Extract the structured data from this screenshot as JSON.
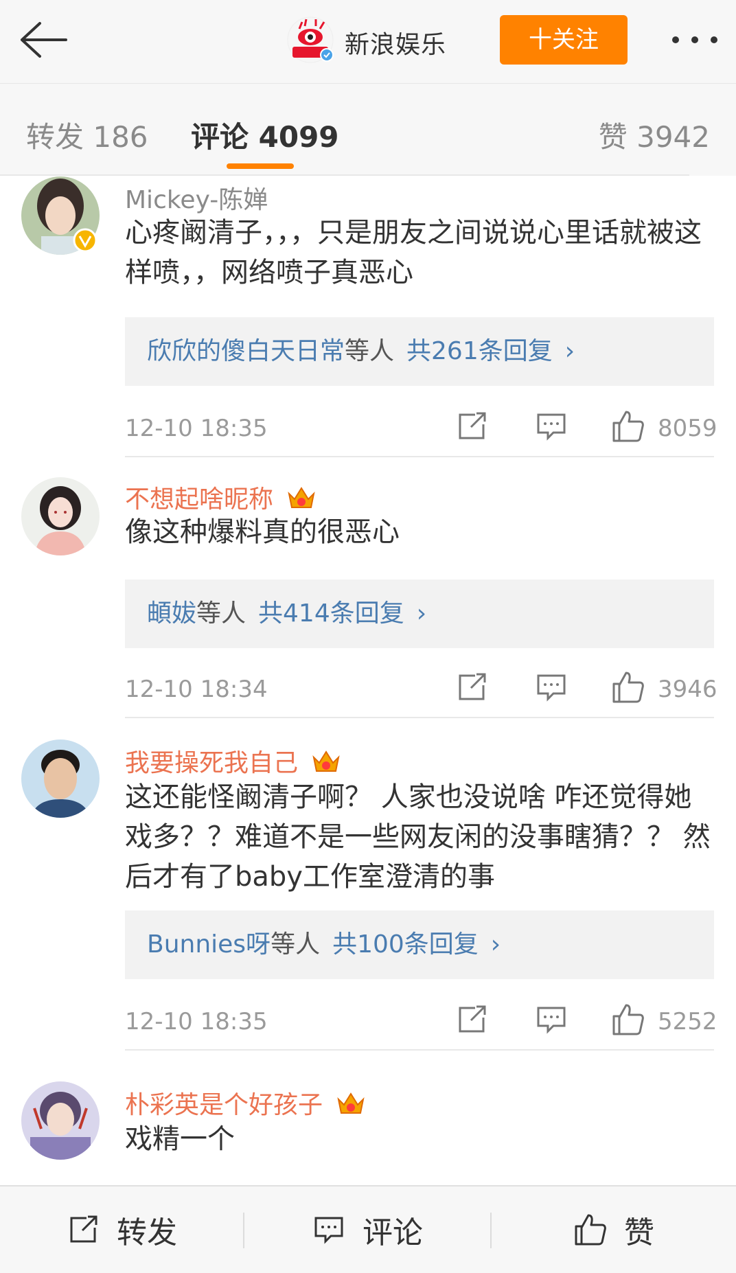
{
  "header": {
    "account_name": "新浪娱乐",
    "follow_label": "十关注",
    "avatar_badge_text": "新浪娱乐"
  },
  "tabs": {
    "repost": "转发 186",
    "comment": "评论 4099",
    "like": "赞 3942"
  },
  "comments": [
    {
      "user": "Mickey-陈婵",
      "text": "心疼阚清子，，，只是朋友之间说说心里话就被这样喷，，网络喷子真恶心",
      "reply_users": "欣欣的傻白天日常",
      "reply_mid": "等人",
      "reply_count": "共261条回复",
      "time": "12-10 18:35",
      "likes": "8059"
    },
    {
      "user": "不想起啥昵称",
      "text": "像这种爆料真的很恶心",
      "reply_users": "頔妭",
      "reply_mid": "等人",
      "reply_count": "共414条回复",
      "time": "12-10 18:34",
      "likes": "3946"
    },
    {
      "user": "我要操死我自己",
      "text": "这还能怪阚清子啊？ 人家也没说啥 咋还觉得她戏多？？难道不是一些网友闲的没事瞎猜？？ 然后才有了baby工作室澄清的事",
      "reply_users": "Bunnies呀",
      "reply_mid": "等人",
      "reply_count": "共100条回复",
      "time": "12-10 18:35",
      "likes": "5252"
    },
    {
      "user": "朴彩英是个好孩子",
      "text": "戏精一个"
    }
  ],
  "bottom": {
    "repost": "转发",
    "comment": "评论",
    "like": "赞"
  },
  "colors": {
    "accent": "#ff8200",
    "vip_name": "#eb7350",
    "link": "#4a7cb0"
  },
  "icons": {
    "back": "arrow-left-icon",
    "more": "more-dots-icon",
    "verified": "verified-badge-icon",
    "crown": "vip-crown-icon",
    "share": "share-icon",
    "reply": "comment-icon",
    "like": "thumbs-up-icon"
  }
}
